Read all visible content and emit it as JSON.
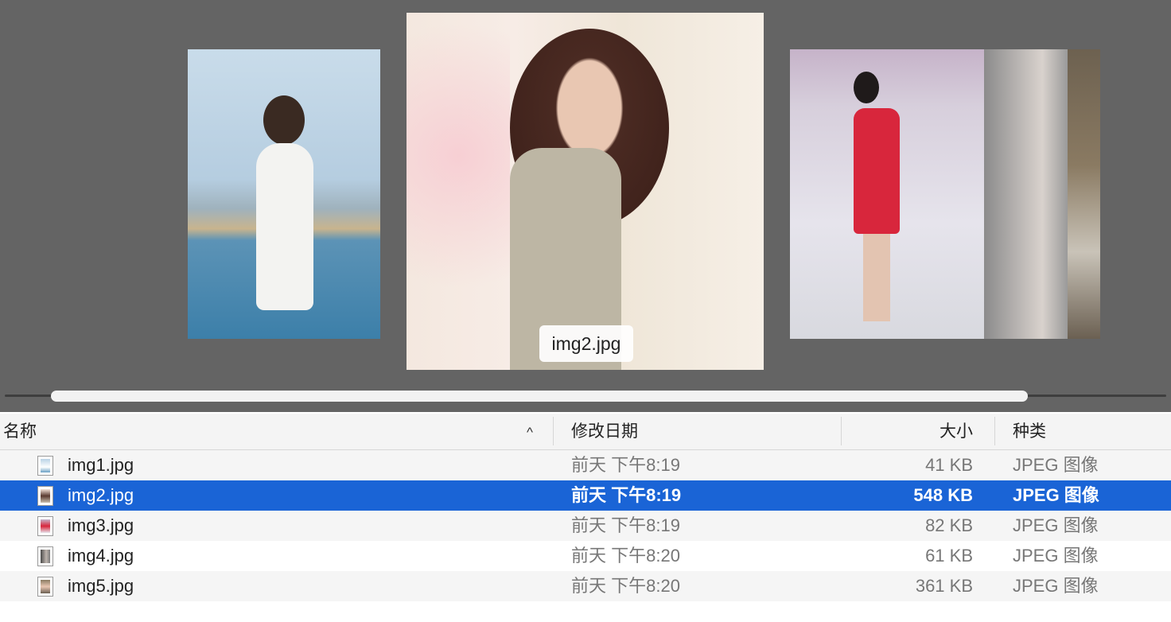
{
  "coverflow": {
    "selected_caption": "img2.jpg",
    "thumbnails": [
      {
        "file": "img1.jpg"
      },
      {
        "file": "img2.jpg"
      },
      {
        "file": "img3.jpg"
      },
      {
        "file": "img4.jpg"
      },
      {
        "file": "img5.jpg"
      }
    ]
  },
  "columns": {
    "name": "名称",
    "date": "修改日期",
    "size": "大小",
    "kind": "种类"
  },
  "sort": {
    "column": "name",
    "direction": "ascending",
    "icon": "chevron-up-icon"
  },
  "files": [
    {
      "name": "img1.jpg",
      "date": "前天 下午8:19",
      "size": "41 KB",
      "kind": "JPEG 图像",
      "selected": false
    },
    {
      "name": "img2.jpg",
      "date": "前天 下午8:19",
      "size": "548 KB",
      "kind": "JPEG 图像",
      "selected": true
    },
    {
      "name": "img3.jpg",
      "date": "前天 下午8:19",
      "size": "82 KB",
      "kind": "JPEG 图像",
      "selected": false
    },
    {
      "name": "img4.jpg",
      "date": "前天 下午8:20",
      "size": "61 KB",
      "kind": "JPEG 图像",
      "selected": false
    },
    {
      "name": "img5.jpg",
      "date": "前天 下午8:20",
      "size": "361 KB",
      "kind": "JPEG 图像",
      "selected": false
    }
  ],
  "colors": {
    "coverflow_bg": "#646464",
    "selection": "#1a64d6",
    "row_alt": "#f5f5f5"
  }
}
